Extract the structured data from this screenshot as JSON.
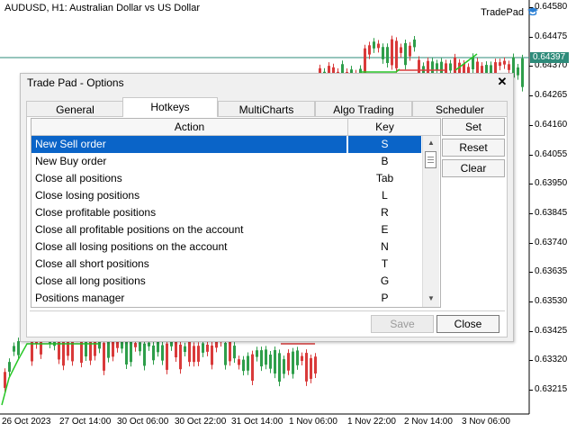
{
  "chart": {
    "title": "AUDUSD, H1:  Australian Dollar vs US Dollar",
    "tradepad_label": "TradePad",
    "current_price": "0.64397",
    "price_levels": [
      "0.64580",
      "0.64475",
      "0.64370",
      "0.64265",
      "0.64160",
      "0.64055",
      "0.63950",
      "0.63845",
      "0.63740",
      "0.63635",
      "0.63530",
      "0.63425",
      "0.63320",
      "0.63215"
    ],
    "time_labels": [
      "26 Oct 2023",
      "27 Oct 14:00",
      "30 Oct 06:00",
      "30 Oct 22:00",
      "31 Oct 14:00",
      "1 Nov 06:00",
      "1 Nov 22:00",
      "2 Nov 14:00",
      "3 Nov 06:00"
    ],
    "colors": {
      "bull": "#2e9e4a",
      "bear": "#d93a3a",
      "trend": "#28c828",
      "grid_line": "#2e8b7a"
    }
  },
  "dialog": {
    "title": "Trade Pad - Options",
    "close_icon": "close-icon",
    "tabs": [
      {
        "label": "General",
        "active": false
      },
      {
        "label": "Hotkeys",
        "active": true
      },
      {
        "label": "MultiCharts",
        "active": false
      },
      {
        "label": "Algo Trading",
        "active": false
      },
      {
        "label": "Scheduler",
        "active": false
      }
    ],
    "table": {
      "headers": {
        "action": "Action",
        "key": "Key"
      },
      "rows": [
        {
          "action": "New Sell order",
          "key": "S",
          "selected": true
        },
        {
          "action": "New Buy order",
          "key": "B",
          "selected": false
        },
        {
          "action": "Close all positions",
          "key": "Tab",
          "selected": false
        },
        {
          "action": "Close losing positions",
          "key": "L",
          "selected": false
        },
        {
          "action": "Close profitable positions",
          "key": "R",
          "selected": false
        },
        {
          "action": "Close all profitable positions on the account",
          "key": "E",
          "selected": false
        },
        {
          "action": "Close all losing positions on the account",
          "key": "N",
          "selected": false
        },
        {
          "action": "Close all short positions",
          "key": "T",
          "selected": false
        },
        {
          "action": "Close all long positions",
          "key": "G",
          "selected": false
        },
        {
          "action": "Positions manager",
          "key": "P",
          "selected": false
        }
      ]
    },
    "side_buttons": {
      "set": "Set",
      "reset": "Reset",
      "clear": "Clear"
    },
    "footer_buttons": {
      "save": "Save",
      "close": "Close"
    }
  }
}
